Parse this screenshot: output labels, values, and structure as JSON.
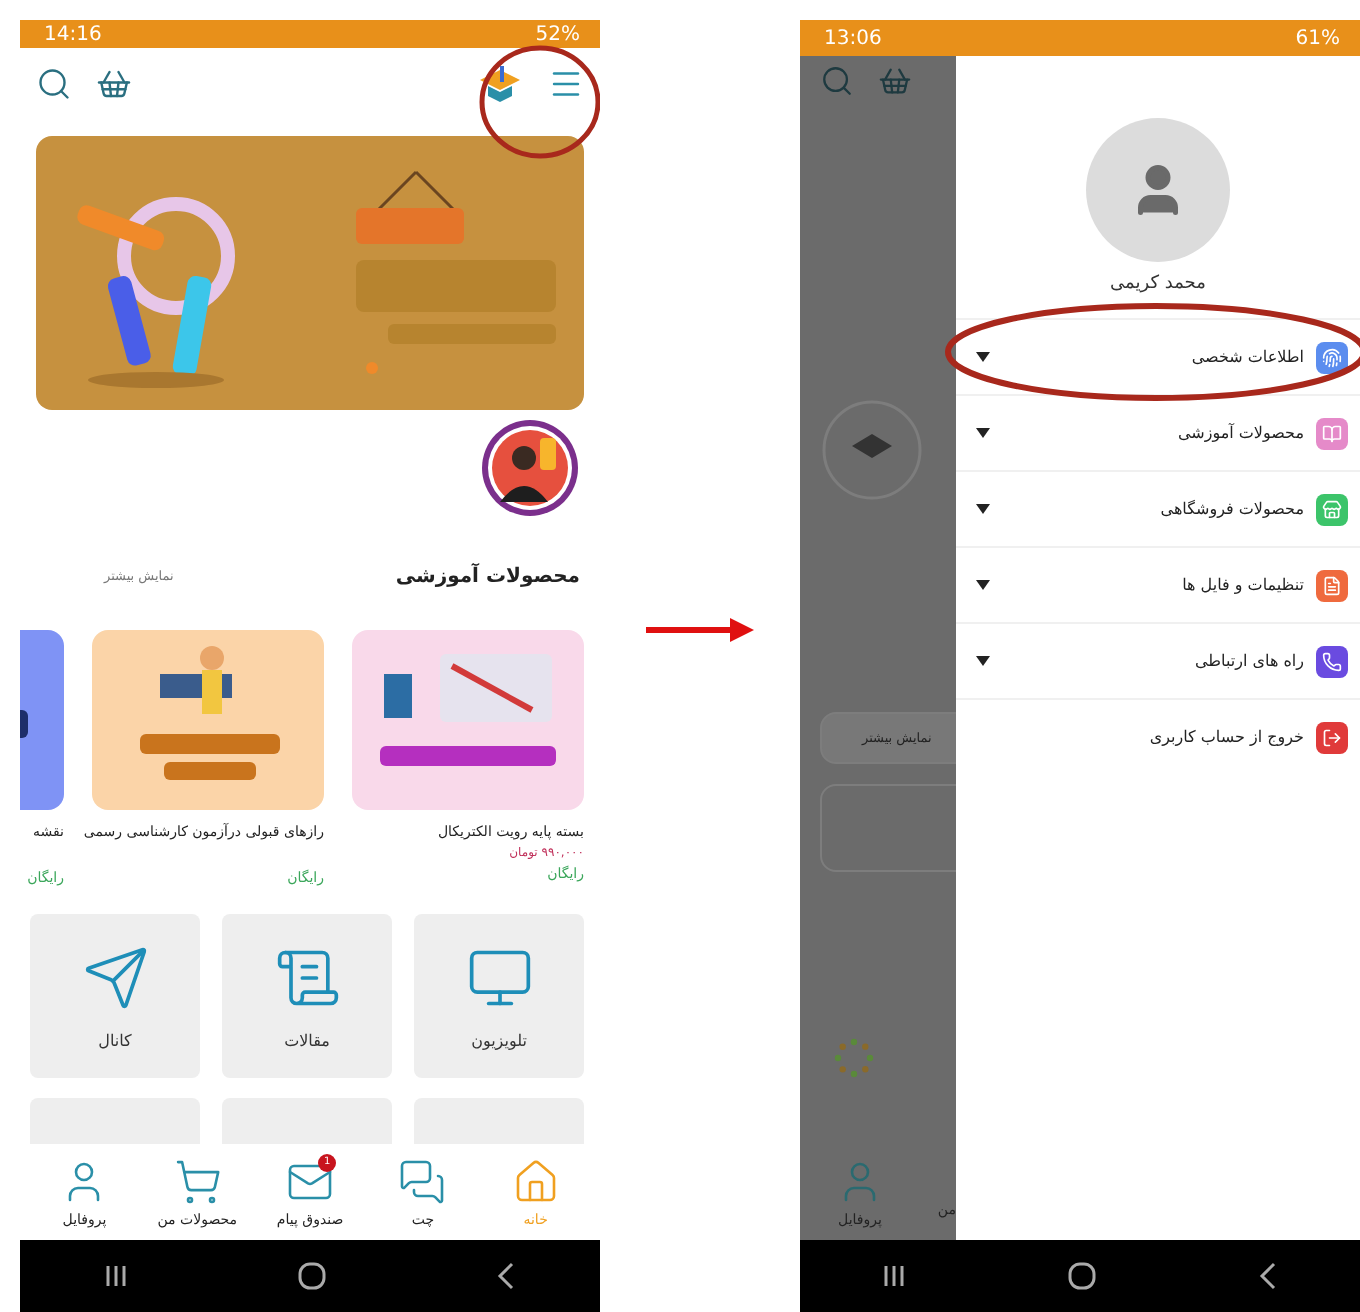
{
  "left_screen": {
    "status_bar": {
      "time": "14:16",
      "battery": "52%"
    },
    "section": {
      "title": "محصولات آموزشی",
      "more": "نمایش بیشتر"
    },
    "products": [
      {
        "title": "بسته پایه رویت الکتریکال",
        "price": "۹۹۰,۰۰۰ تومان",
        "offer": "رایگان",
        "color": "#f9d9ea"
      },
      {
        "title": "رازهای قبولی درآزمون کارشناسی رسمی",
        "offer": "رایگان",
        "color": "#fbd4a8"
      },
      {
        "title": "نقشه",
        "offer": "رایگان",
        "color": "#7f93f5"
      }
    ],
    "tiles": [
      {
        "label": "تلویزیون",
        "kind": "tv"
      },
      {
        "label": "مقالات",
        "kind": "article"
      },
      {
        "label": "کانال",
        "kind": "channel"
      }
    ],
    "bottom_nav": [
      {
        "label": "خانه",
        "kind": "home",
        "selected": true
      },
      {
        "label": "چت",
        "kind": "chat",
        "selected": false
      },
      {
        "label": "صندوق پیام",
        "kind": "mail",
        "selected": false,
        "badge": "1"
      },
      {
        "label": "محصولات من",
        "kind": "cart",
        "selected": false
      },
      {
        "label": "پروفایل",
        "kind": "profile",
        "selected": false
      }
    ]
  },
  "right_screen": {
    "status_bar": {
      "time": "13:06",
      "battery": "61%"
    },
    "background": {
      "more": "نمایش بیشتر",
      "nav_labels": [
        "من",
        "پروفایل"
      ]
    },
    "drawer": {
      "user_name": "محمد کریمی",
      "items": [
        {
          "label": "اطلاعات شخصی",
          "kind": "personal",
          "color": "#5b8def",
          "expandable": true
        },
        {
          "label": "محصولات آموزشی",
          "kind": "education",
          "color": "#e58ac9",
          "expandable": true
        },
        {
          "label": "محصولات فروشگاهی",
          "kind": "store",
          "color": "#3cc46a",
          "expandable": true
        },
        {
          "label": "تنظیمات و فایل ها",
          "kind": "files",
          "color": "#ef6a3e",
          "expandable": true
        },
        {
          "label": "راه های ارتباطی",
          "kind": "contact",
          "color": "#6a4be0",
          "expandable": true
        },
        {
          "label": "خروج از حساب کاربری",
          "kind": "logout",
          "color": "#e03a3a",
          "expandable": false
        }
      ]
    }
  }
}
